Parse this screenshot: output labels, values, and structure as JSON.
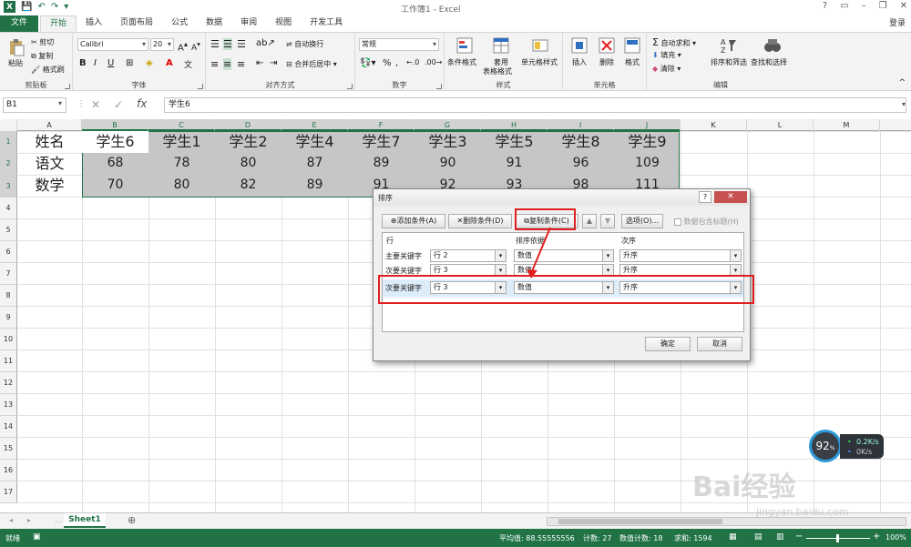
{
  "window": {
    "title": "工作簿1 - Excel",
    "help": "?",
    "login": "登录"
  },
  "tabs": [
    "文件",
    "开始",
    "插入",
    "页面布局",
    "公式",
    "数据",
    "审阅",
    "视图",
    "开发工具"
  ],
  "ribbon": {
    "clipboard": {
      "label": "剪贴板",
      "paste": "粘贴",
      "cut": "剪切",
      "copy": "复制",
      "painter": "格式刷"
    },
    "font": {
      "label": "字体",
      "name": "Calibri",
      "size": "20",
      "bold": "B",
      "italic": "I",
      "underline": "U",
      "grow": "A",
      "shrink": "A"
    },
    "align": {
      "label": "对齐方式",
      "wrap": "自动换行",
      "merge": "合并后居中"
    },
    "number": {
      "label": "数字",
      "format": "常规",
      "percent": "%",
      "comma": ","
    },
    "styles": {
      "label": "样式",
      "cond": "条件格式",
      "table1": "套用",
      "table2": "表格格式",
      "cell": "单元格样式"
    },
    "cells": {
      "label": "单元格",
      "insert": "插入",
      "delete": "删除",
      "format": "格式"
    },
    "editing": {
      "label": "编辑",
      "autosum": "自动求和",
      "fill": "填充",
      "clear": "清除",
      "sort": "排序和筛选",
      "find": "查找和选择"
    }
  },
  "formula": {
    "namebox": "B1",
    "fx": "fx",
    "content": "学生6"
  },
  "columns": [
    "A",
    "B",
    "C",
    "D",
    "E",
    "F",
    "G",
    "H",
    "I",
    "J",
    "K",
    "L",
    "M"
  ],
  "rows": [
    "1",
    "2",
    "3",
    "4",
    "5",
    "6",
    "7",
    "8",
    "9",
    "10",
    "11",
    "12",
    "13",
    "14",
    "15",
    "16",
    "17",
    "18",
    "19",
    "20",
    "21",
    "22"
  ],
  "sheet": {
    "r1": [
      "姓名",
      "学生6",
      "学生1",
      "学生2",
      "学生4",
      "学生7",
      "学生3",
      "学生5",
      "学生8",
      "学生9"
    ],
    "r2": [
      "语文",
      "68",
      "78",
      "80",
      "87",
      "89",
      "90",
      "91",
      "96",
      "109"
    ],
    "r3": [
      "数学",
      "70",
      "80",
      "82",
      "89",
      "91",
      "92",
      "93",
      "98",
      "111"
    ]
  },
  "sheettab": "Sheet1",
  "statusbar": {
    "ready": "就绪",
    "avg": "平均值: 88.55555556",
    "count": "计数: 27",
    "numcount": "数值计数: 18",
    "sum": "求和: 1594",
    "zoom": "100%"
  },
  "dialog": {
    "title": "排序",
    "help": "?",
    "add": "添加条件(A)",
    "del": "删除条件(D)",
    "copy": "复制条件(C)",
    "options": "选项(O)...",
    "header": "数据包含标题(H)",
    "col_row": "行",
    "col_basis": "排序依据",
    "col_order": "次序",
    "rows": [
      {
        "label": "主要关键字",
        "key": "行 2",
        "basis": "数值",
        "order": "升序"
      },
      {
        "label": "次要关键字",
        "key": "行 3",
        "basis": "数值",
        "order": "升序"
      },
      {
        "label": "次要关键字",
        "key": "行 3",
        "basis": "数值",
        "order": "升序"
      }
    ],
    "ok": "确定",
    "cancel": "取消"
  },
  "overlay": {
    "gauge": "92",
    "up": "0.2",
    "down": "0",
    "unit_up": "K/s",
    "unit_down": "K/s",
    "watermark": "Bai经验",
    "wm_url": "jingyan.baidu.com"
  }
}
